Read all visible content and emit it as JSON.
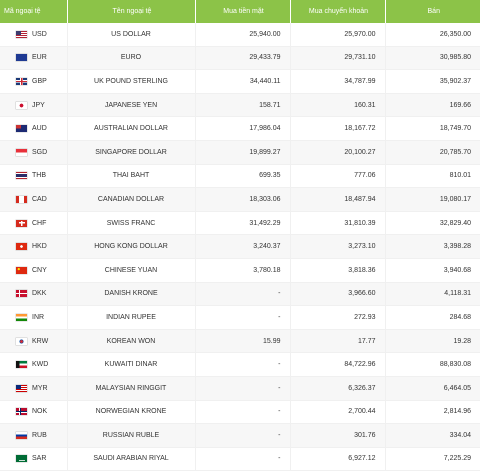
{
  "header": {
    "code": "Mã ngoại tệ",
    "name": "Tên ngoại tệ",
    "cash_buy": "Mua tiền mặt",
    "transfer_buy": "Mua chuyển khoản",
    "sell": "Bán"
  },
  "colors": {
    "header_bg": "#8cc348",
    "header_text": "#ffffff",
    "row_alt": "#f7f7f7"
  },
  "rows": [
    {
      "flag": "us-flag-icon",
      "code": "USD",
      "name": "US DOLLAR",
      "cash": "25,940.00",
      "transfer": "25,970.00",
      "sell": "26,350.00"
    },
    {
      "flag": "eu-flag-icon",
      "code": "EUR",
      "name": "EURO",
      "cash": "29,433.79",
      "transfer": "29,731.10",
      "sell": "30,985.80"
    },
    {
      "flag": "uk-flag-icon",
      "code": "GBP",
      "name": "UK POUND STERLING",
      "cash": "34,440.11",
      "transfer": "34,787.99",
      "sell": "35,902.37"
    },
    {
      "flag": "japan-flag-icon",
      "code": "JPY",
      "name": "JAPANESE YEN",
      "cash": "158.71",
      "transfer": "160.31",
      "sell": "169.66"
    },
    {
      "flag": "australia-flag-icon",
      "code": "AUD",
      "name": "AUSTRALIAN DOLLAR",
      "cash": "17,986.04",
      "transfer": "18,167.72",
      "sell": "18,749.70"
    },
    {
      "flag": "singapore-flag-icon",
      "code": "SGD",
      "name": "SINGAPORE DOLLAR",
      "cash": "19,899.27",
      "transfer": "20,100.27",
      "sell": "20,785.70"
    },
    {
      "flag": "thailand-flag-icon",
      "code": "THB",
      "name": "THAI BAHT",
      "cash": "699.35",
      "transfer": "777.06",
      "sell": "810.01"
    },
    {
      "flag": "canada-flag-icon",
      "code": "CAD",
      "name": "CANADIAN DOLLAR",
      "cash": "18,303.06",
      "transfer": "18,487.94",
      "sell": "19,080.17"
    },
    {
      "flag": "switzerland-flag-icon",
      "code": "CHF",
      "name": "SWISS FRANC",
      "cash": "31,492.29",
      "transfer": "31,810.39",
      "sell": "32,829.40"
    },
    {
      "flag": "hong-kong-flag-icon",
      "code": "HKD",
      "name": "HONG KONG DOLLAR",
      "cash": "3,240.37",
      "transfer": "3,273.10",
      "sell": "3,398.28"
    },
    {
      "flag": "china-flag-icon",
      "code": "CNY",
      "name": "CHINESE YUAN",
      "cash": "3,780.18",
      "transfer": "3,818.36",
      "sell": "3,940.68"
    },
    {
      "flag": "denmark-flag-icon",
      "code": "DKK",
      "name": "DANISH KRONE",
      "cash": "-",
      "transfer": "3,966.60",
      "sell": "4,118.31"
    },
    {
      "flag": "india-flag-icon",
      "code": "INR",
      "name": "INDIAN RUPEE",
      "cash": "-",
      "transfer": "272.93",
      "sell": "284.68"
    },
    {
      "flag": "korea-flag-icon",
      "code": "KRW",
      "name": "KOREAN WON",
      "cash": "15.99",
      "transfer": "17.77",
      "sell": "19.28"
    },
    {
      "flag": "kuwait-flag-icon",
      "code": "KWD",
      "name": "KUWAITI DINAR",
      "cash": "-",
      "transfer": "84,722.96",
      "sell": "88,830.08"
    },
    {
      "flag": "malaysia-flag-icon",
      "code": "MYR",
      "name": "MALAYSIAN RINGGIT",
      "cash": "-",
      "transfer": "6,326.37",
      "sell": "6,464.05"
    },
    {
      "flag": "norway-flag-icon",
      "code": "NOK",
      "name": "NORWEGIAN KRONE",
      "cash": "-",
      "transfer": "2,700.44",
      "sell": "2,814.96"
    },
    {
      "flag": "russia-flag-icon",
      "code": "RUB",
      "name": "RUSSIAN RUBLE",
      "cash": "-",
      "transfer": "301.76",
      "sell": "334.04"
    },
    {
      "flag": "saudi-arabia-flag-icon",
      "code": "SAR",
      "name": "SAUDI ARABIAN RIYAL",
      "cash": "-",
      "transfer": "6,927.12",
      "sell": "7,225.29"
    }
  ]
}
